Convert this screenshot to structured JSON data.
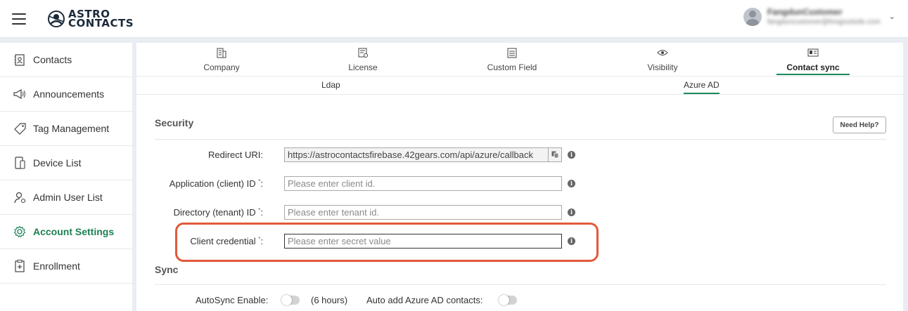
{
  "brand": {
    "line1": "ASTRO",
    "line2": "CONTACTS"
  },
  "user": {
    "name": "FangdunCustomer",
    "email": "fangduncustomer@fongoutside.com"
  },
  "sidebar": {
    "items": [
      {
        "label": "Contacts",
        "icon": "contacts-icon"
      },
      {
        "label": "Announcements",
        "icon": "megaphone-icon"
      },
      {
        "label": "Tag Management",
        "icon": "tag-icon"
      },
      {
        "label": "Device List",
        "icon": "device-icon"
      },
      {
        "label": "Admin User List",
        "icon": "admin-user-icon"
      },
      {
        "label": "Account Settings",
        "icon": "gear-icon",
        "active": true
      },
      {
        "label": "Enrollment",
        "icon": "enrollment-icon"
      }
    ]
  },
  "tabs": [
    {
      "label": "Company",
      "icon": "company-icon"
    },
    {
      "label": "License",
      "icon": "license-icon"
    },
    {
      "label": "Custom Field",
      "icon": "custom-field-icon"
    },
    {
      "label": "Visibility",
      "icon": "eye-icon"
    },
    {
      "label": "Contact sync",
      "icon": "contact-sync-icon",
      "active": true
    }
  ],
  "subtabs": [
    {
      "label": "Ldap"
    },
    {
      "label": "Azure AD",
      "active": true
    }
  ],
  "security": {
    "title": "Security",
    "help_label": "Need Help?",
    "redirect_uri": {
      "label": "Redirect URI:",
      "value": "https://astrocontactsfirebase.42gears.com/api/azure/callback"
    },
    "client_id": {
      "label": "Application (client) ID",
      "suffix": ":",
      "placeholder": "Please enter client id."
    },
    "tenant_id": {
      "label": "Directory (tenant) ID",
      "suffix": ":",
      "placeholder": "Please enter tenant id."
    },
    "client_credential": {
      "label": "Client credential",
      "suffix": ":",
      "placeholder": "Please enter secret value"
    },
    "required_mark": "*"
  },
  "sync": {
    "title": "Sync",
    "autosync_label": "AutoSync Enable:",
    "autosync_enabled": false,
    "autosync_interval": "(6 hours)",
    "auto_add_label": "Auto add Azure AD contacts:",
    "auto_add_enabled": false
  },
  "colors": {
    "accent": "#1d8a5b",
    "highlight": "#e05a3a"
  }
}
